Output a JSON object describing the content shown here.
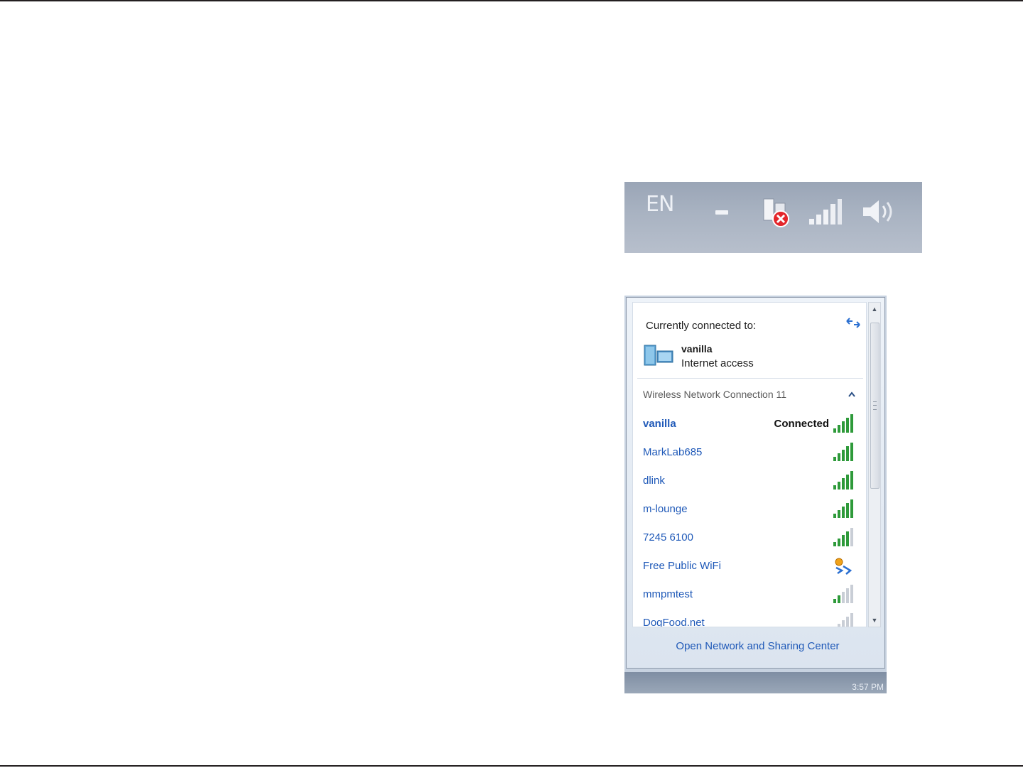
{
  "tray": {
    "language": "EN",
    "icons": [
      "minimize-dash-icon",
      "network-disconnected-icon",
      "signal-bars-icon",
      "speaker-icon"
    ],
    "error_color": "#e3262b"
  },
  "flyout": {
    "currently_connected_label": "Currently connected to:",
    "connection_name": "vanilla",
    "connection_status": "Internet access",
    "adapter_name": "Wireless Network Connection 11",
    "networks": [
      {
        "name": "vanilla",
        "state": "Connected",
        "signal": 5,
        "current": true
      },
      {
        "name": "MarkLab685",
        "state": "",
        "signal": 5,
        "current": false
      },
      {
        "name": "dlink",
        "state": "",
        "signal": 5,
        "current": false
      },
      {
        "name": "m-lounge",
        "state": "",
        "signal": 5,
        "current": false
      },
      {
        "name": "7245 6100",
        "state": "",
        "signal": 4,
        "current": false
      },
      {
        "name": "Free Public WiFi",
        "state": "",
        "signal": 0,
        "current": false,
        "icon": "adhoc-network-icon"
      },
      {
        "name": "mmpmtest",
        "state": "",
        "signal": 2,
        "current": false
      },
      {
        "name": "DogFood.net",
        "state": "",
        "signal": 1,
        "current": false
      }
    ],
    "footer_link": "Open Network and Sharing Center",
    "taskbar_clock": "3:57 PM",
    "link_color": "#1f59b8",
    "signal_color": "#2e9a3a"
  }
}
